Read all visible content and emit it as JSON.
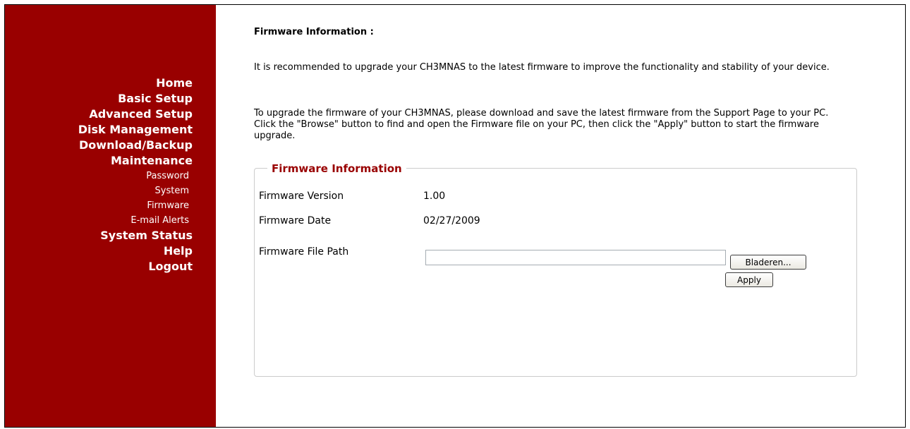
{
  "sidebar": {
    "items": [
      {
        "label": "Home"
      },
      {
        "label": "Basic Setup"
      },
      {
        "label": "Advanced Setup"
      },
      {
        "label": "Disk Management"
      },
      {
        "label": "Download/Backup"
      },
      {
        "label": "Maintenance"
      },
      {
        "label": "Password"
      },
      {
        "label": "System"
      },
      {
        "label": "Firmware"
      },
      {
        "label": "E-mail Alerts"
      },
      {
        "label": "System Status"
      },
      {
        "label": "Help"
      },
      {
        "label": "Logout"
      }
    ]
  },
  "main": {
    "heading": "Firmware Information :",
    "paragraph1": "It is recommended to upgrade your CH3MNAS to the latest firmware to improve the functionality and stability of your device.",
    "paragraph2": "To upgrade the firmware of your CH3MNAS, please download and save the latest firmware from the Support Page to your PC. Click the \"Browse\" button to find and open the Firmware file on your PC, then click the \"Apply\" button to start the firmware upgrade.",
    "fieldset": {
      "legend": "Firmware Information",
      "version_label": "Firmware Version",
      "version_value": "1.00",
      "date_label": "Firmware Date",
      "date_value": "02/27/2009",
      "path_label": "Firmware File Path",
      "path_value": "",
      "browse_label": "Bladeren...",
      "apply_label": "Apply"
    }
  },
  "colors": {
    "sidebar_bg": "#990000",
    "legend_text": "#990000"
  }
}
